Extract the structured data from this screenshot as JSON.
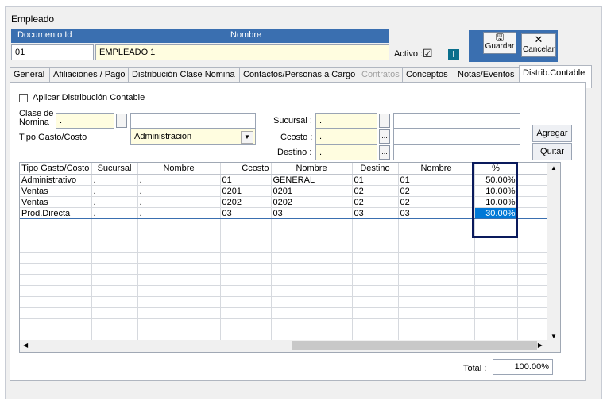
{
  "window": {
    "title": "Empleado"
  },
  "header": {
    "doc_label": "Documento Id",
    "name_label": "Nombre",
    "doc_value": "01",
    "name_value": "EMPLEADO 1",
    "activo_label": "Activo :",
    "activo_check": "☑",
    "info_icon": "i"
  },
  "toolbar": {
    "guardar_label": "Guardar",
    "cancelar_label": "Cancelar",
    "guardar_icon": "🖫",
    "cancelar_icon": "✕"
  },
  "tabs": [
    {
      "label": "General"
    },
    {
      "label": "Afiliaciones / Pago"
    },
    {
      "label": "Distribución Clase Nomina"
    },
    {
      "label": "Contactos/Personas a Cargo"
    },
    {
      "label": "Contratos"
    },
    {
      "label": "Conceptos"
    },
    {
      "label": "Notas/Eventos"
    },
    {
      "label": "Distrib.Contable"
    }
  ],
  "form": {
    "aplicar_label": "Aplicar Distribución Contable",
    "clase_label": "Clase de Nomina",
    "clase_value": ".",
    "tipo_label": "Tipo Gasto/Costo",
    "tipo_value": "Administracion",
    "sucursal_label": "Sucursal :",
    "sucursal_value": ".",
    "ccosto_label": "Ccosto :",
    "ccosto_value": ".",
    "destino_label": "Destino :",
    "destino_value": ".",
    "ellipsis": "...",
    "agregar_label": "Agregar",
    "quitar_label": "Quitar"
  },
  "grid": {
    "columns": [
      "Tipo Gasto/Costo",
      "Sucursal",
      "Nombre",
      "Ccosto",
      "Nombre",
      "Destino",
      "Nombre",
      "%"
    ],
    "rows": [
      [
        "Administrativo",
        ".",
        ".",
        "01",
        "GENERAL",
        "01",
        "01",
        "50.00%"
      ],
      [
        "Ventas",
        ".",
        ".",
        "0201",
        "0201",
        "02",
        "02",
        "10.00%"
      ],
      [
        "Ventas",
        ".",
        ".",
        "0202",
        "0202",
        "02",
        "02",
        "10.00%"
      ],
      [
        "Prod.Directa",
        ".",
        ".",
        "03",
        "03",
        "03",
        "03",
        "30.00%"
      ]
    ]
  },
  "footer": {
    "total_label": "Total :",
    "total_value": "100.00%"
  },
  "scroll": {
    "up": "▲",
    "down": "▼",
    "left": "◀",
    "right": "▶"
  }
}
